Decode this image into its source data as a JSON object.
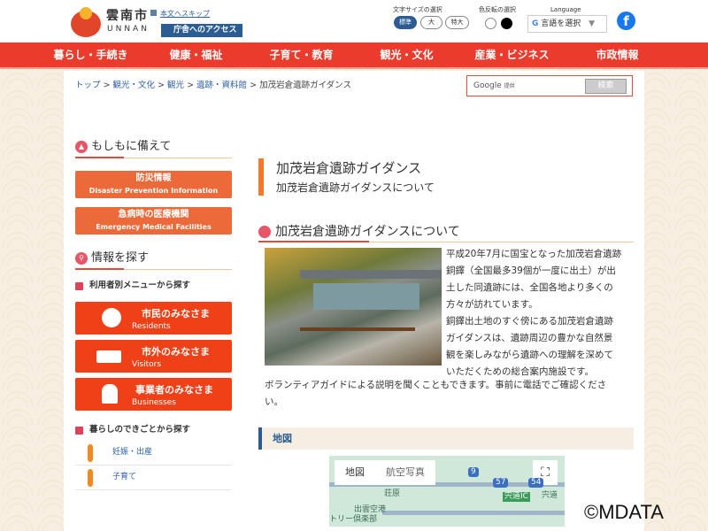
{
  "header": {
    "city_jp": "雲南市",
    "city_en": "UNNAN",
    "skip_link": "本文へスキップ",
    "access_button": "庁舎へのアクセス",
    "font_size_label": "文字サイズの選択",
    "font_sizes": [
      "標準",
      "大",
      "特大"
    ],
    "color_label": "色反転の選択",
    "language_label": "Language",
    "language_select": "言語を選択",
    "facebook": "f"
  },
  "nav": [
    "暮らし・手続き",
    "健康・福祉",
    "子育て・教育",
    "観光・文化",
    "産業・ビジネス",
    "市政情報"
  ],
  "breadcrumb": {
    "items": [
      "トップ",
      "観光・文化",
      "観光",
      "遺跡・資料館"
    ],
    "sep": " > ",
    "current": "加茂岩倉遺跡ガイダンス"
  },
  "search": {
    "brand": "Google",
    "note": "提供",
    "button": "検索"
  },
  "sidebar": {
    "emergency_title": "もしもに備えて",
    "disaster_jp": "防災情報",
    "disaster_en": "Disaster Prevention Information",
    "medical_jp": "急病時の医療機関",
    "medical_en": "Emergency Medical Facilities",
    "find_title": "情報を探す",
    "by_user": "利用者別メニューから探す",
    "residents_jp": "市民のみなさま",
    "residents_en": "Residents",
    "visitors_jp": "市外のみなさま",
    "visitors_en": "Visitors",
    "business_jp": "事業者のみなさま",
    "business_en": "Businesses",
    "by_life": "暮らしのできごとから探す",
    "life_items": [
      "妊娠・出産",
      "子育て"
    ]
  },
  "main": {
    "title": "加茂岩倉遺跡ガイダンス",
    "subtitle": "加茂岩倉遺跡ガイダンスについて",
    "section_title": "加茂岩倉遺跡ガイダンスについて",
    "lines": [
      "平成20年7月に国宝となった加茂岩倉遺跡",
      "銅鐸（全国最多39個が一度に出土）が出",
      "土した同遺跡には、全国各地より多くの",
      "方々が訪れています。",
      "銅鐸出土地のすぐ傍にある加茂岩倉遺跡",
      "ガイダンスは、遺跡周辺の豊かな自然景",
      "観を楽しみながら遺跡への理解を深めて",
      "いただくための総合案内施設です。"
    ],
    "full_line1": "ボランティアガイドによる説明を聞くこともできます。事前に電話でご確認くださ",
    "full_line2": "い。",
    "map_heading": "地図"
  },
  "map": {
    "tab_map": "地図",
    "tab_satellite": "航空写真",
    "fullscreen": "⛶",
    "labels": [
      "荘原",
      "出雲空港",
      "トリー倶楽部",
      "宍道IC",
      "宍道",
      "9",
      "57",
      "54"
    ]
  },
  "watermark": "©MDATA"
}
